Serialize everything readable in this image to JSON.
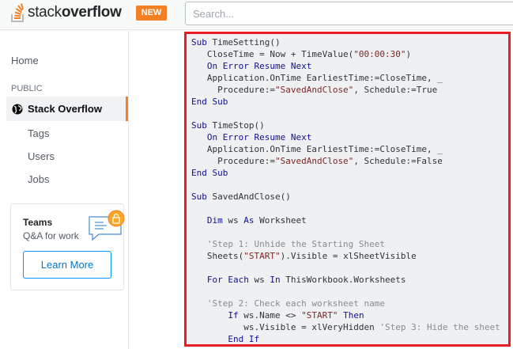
{
  "header": {
    "logo": {
      "light": "stack",
      "bold": "overflow"
    },
    "new_badge": "NEW",
    "search_placeholder": "Search..."
  },
  "sidebar": {
    "home": "Home",
    "section": "PUBLIC",
    "active": "Stack Overflow",
    "items": [
      "Tags",
      "Users",
      "Jobs"
    ]
  },
  "teams": {
    "title": "Teams",
    "subtitle": "Q&A for work",
    "button": "Learn More"
  },
  "colors": {
    "accent": "#f48024",
    "highlight_border": "#ec1c24",
    "keyword": "#101094",
    "string": "#7d2727",
    "comment": "#858c93"
  },
  "code": [
    [
      [
        "kw",
        "Sub"
      ],
      [
        "pl",
        " TimeSetting()"
      ]
    ],
    [
      [
        "pl",
        "   CloseTime = Now + TimeValue("
      ],
      [
        "str",
        "\"00:00:30\""
      ],
      [
        "pl",
        ")"
      ]
    ],
    [
      [
        "kw",
        "   On Error Resume Next"
      ]
    ],
    [
      [
        "pl",
        "   Application.OnTime EarliestTime:=CloseTime, _"
      ]
    ],
    [
      [
        "pl",
        "     Procedure:="
      ],
      [
        "str",
        "\"SavedAndClose\""
      ],
      [
        "pl",
        ", Schedule:=True"
      ]
    ],
    [
      [
        "kw",
        "End Sub"
      ]
    ],
    [
      [
        "pl",
        ""
      ]
    ],
    [
      [
        "kw",
        "Sub"
      ],
      [
        "pl",
        " TimeStop()"
      ]
    ],
    [
      [
        "kw",
        "   On Error Resume Next"
      ]
    ],
    [
      [
        "pl",
        "   Application.OnTime EarliestTime:=CloseTime, _"
      ]
    ],
    [
      [
        "pl",
        "     Procedure:="
      ],
      [
        "str",
        "\"SavedAndClose\""
      ],
      [
        "pl",
        ", Schedule:=False"
      ]
    ],
    [
      [
        "kw",
        "End Sub"
      ]
    ],
    [
      [
        "pl",
        ""
      ]
    ],
    [
      [
        "kw",
        "Sub"
      ],
      [
        "pl",
        " SavedAndClose()"
      ]
    ],
    [
      [
        "pl",
        ""
      ]
    ],
    [
      [
        "kw",
        "   Dim"
      ],
      [
        "pl",
        " ws "
      ],
      [
        "kw",
        "As"
      ],
      [
        "pl",
        " Worksheet"
      ]
    ],
    [
      [
        "pl",
        ""
      ]
    ],
    [
      [
        "cm",
        "   'Step 1: Unhide the Starting Sheet"
      ]
    ],
    [
      [
        "pl",
        "   Sheets("
      ],
      [
        "str",
        "\"START\""
      ],
      [
        "pl",
        ").Visible = xlSheetVisible"
      ]
    ],
    [
      [
        "pl",
        ""
      ]
    ],
    [
      [
        "kw",
        "   For Each"
      ],
      [
        "pl",
        " ws "
      ],
      [
        "kw",
        "In"
      ],
      [
        "pl",
        " ThisWorkbook.Worksheets"
      ]
    ],
    [
      [
        "pl",
        ""
      ]
    ],
    [
      [
        "cm",
        "   'Step 2: Check each worksheet name"
      ]
    ],
    [
      [
        "kw",
        "       If"
      ],
      [
        "pl",
        " ws.Name <> "
      ],
      [
        "str",
        "\"START\""
      ],
      [
        "kw",
        " Then"
      ]
    ],
    [
      [
        "pl",
        "          ws.Visible = xlVeryHidden "
      ],
      [
        "cm",
        "'Step 3: Hide the sheet"
      ]
    ],
    [
      [
        "kw",
        "       End If"
      ]
    ]
  ]
}
